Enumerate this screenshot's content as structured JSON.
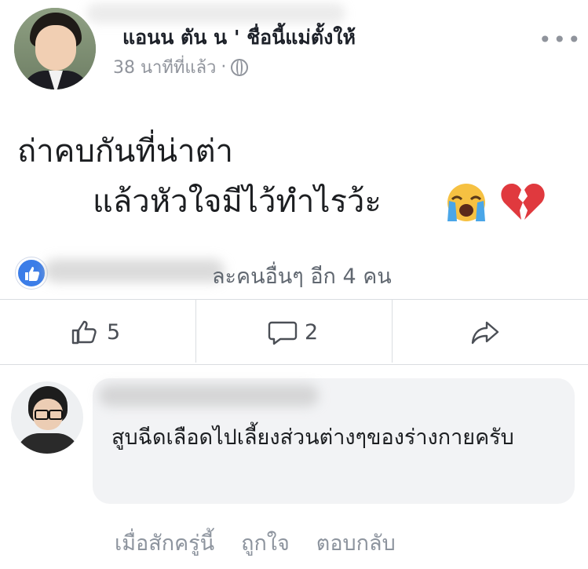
{
  "post": {
    "author": "แอนน ตัน น ' ชื่อนี้แม่ตั้งให้",
    "time": "38 นาทีที่แล้ว",
    "separator": "·",
    "privacy_icon": "globe-icon",
    "more_label": "•••",
    "lines": [
      "ถ่าคบกันที่น่าต่า",
      "แล้วหัวใจมีไว้ทำไรว้ะ"
    ],
    "emojis": [
      "crying-face-icon",
      "broken-heart-icon"
    ]
  },
  "reactions": {
    "icon": "like-icon",
    "summary": "ละคนอื่นๆ อีก 4 คน"
  },
  "actions": {
    "like_count": "5",
    "comment_count": "2",
    "share_icon": "share-icon"
  },
  "comment": {
    "text": "สูบฉีดเลือดไปเลี้ยงส่วนต่างๆของร่างกายครับ",
    "time": "เมื่อสักครู่นี้",
    "like_label": "ถูกใจ",
    "reply_label": "ตอบกลับ"
  },
  "colors": {
    "accent": "#3b7de8",
    "muted": "#90949c",
    "bubble": "#f2f3f5",
    "heart": "#e0393e"
  }
}
